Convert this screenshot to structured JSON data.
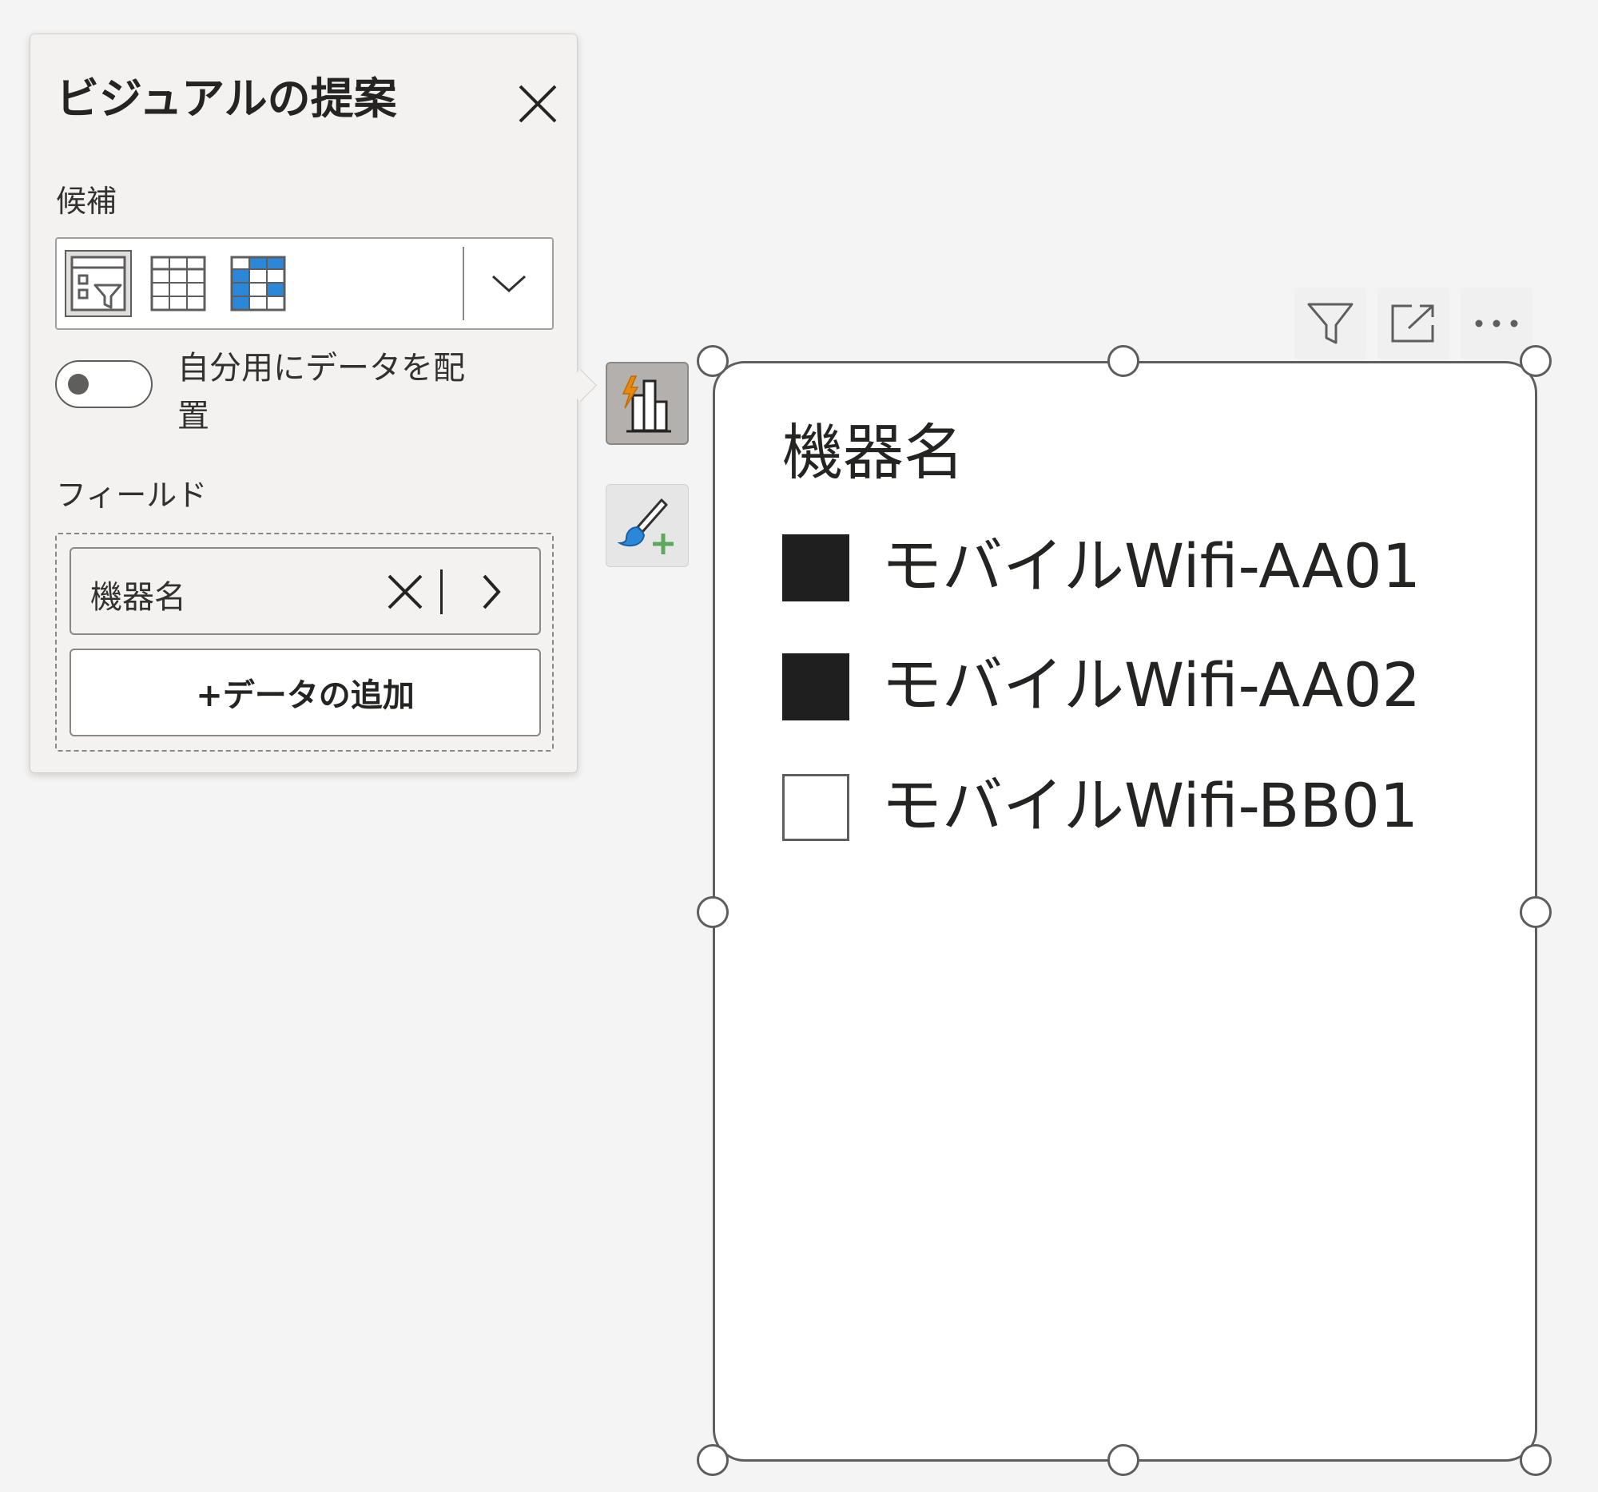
{
  "panel": {
    "title": "ビジュアルの提案",
    "candidates_label": "候補",
    "candidates": [
      {
        "icon": "slicer-icon",
        "selected": true
      },
      {
        "icon": "table-icon",
        "selected": false
      },
      {
        "icon": "matrix-icon",
        "selected": false
      }
    ],
    "toggle_label": "自分用にデータを配置",
    "toggle_on": false,
    "fields_label": "フィールド",
    "field_name": "機器名",
    "add_data_label": "+データの追加"
  },
  "side_buttons": {
    "suggest_icon": "smart-visual-suggest-icon",
    "format_icon": "format-brush-icon"
  },
  "visual_header": {
    "icons": [
      "filter-icon",
      "focus-mode-icon",
      "more-options-icon"
    ]
  },
  "slicer": {
    "title": "機器名",
    "items": [
      {
        "label": "モバイルWifi-AA01",
        "checked": true
      },
      {
        "label": "モバイルWifi-AA02",
        "checked": true
      },
      {
        "label": "モバイルWifi-BB01",
        "checked": false
      }
    ]
  },
  "colors": {
    "accent_orange": "#e8890c",
    "accent_blue": "#2b88d8",
    "plus_green": "#5ea85e",
    "checked_fill": "#1f1f1f"
  }
}
